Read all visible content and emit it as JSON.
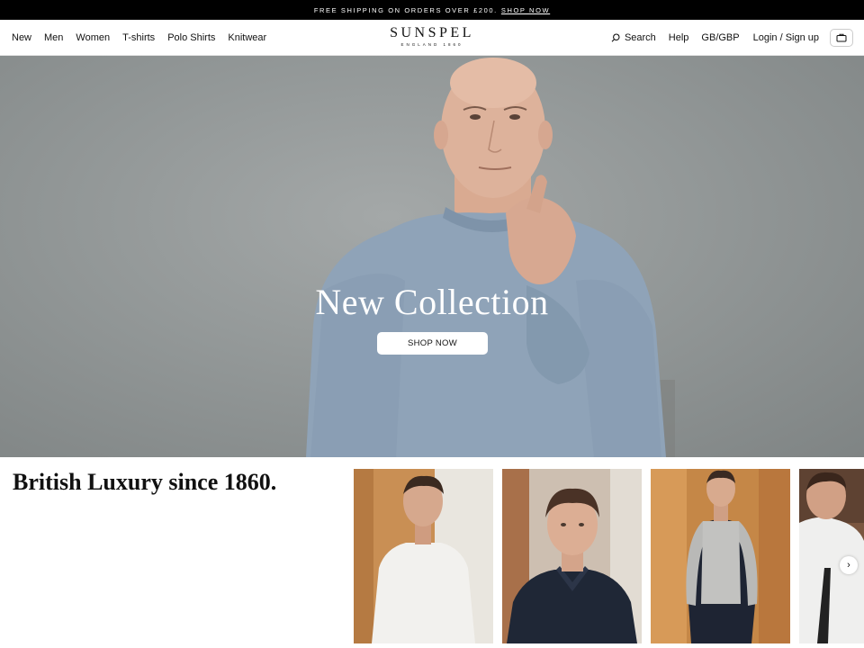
{
  "announcement": {
    "text": "FREE SHIPPING ON ORDERS OVER £200.",
    "link": "SHOP NOW"
  },
  "nav": {
    "left": [
      "New",
      "Men",
      "Women",
      "T-shirts",
      "Polo Shirts",
      "Knitwear"
    ],
    "search_label": "Search",
    "help_label": "Help",
    "region_label": "GB/GBP",
    "login_label": "Login / Sign up"
  },
  "brand": {
    "wordmark": "SUNSPEL",
    "sub": "ENGLAND 1860"
  },
  "hero": {
    "title": "New Collection",
    "button": "SHOP NOW"
  },
  "section": {
    "tagline": "British Luxury since 1860."
  },
  "icons": {
    "search": "search-icon",
    "bag": "bag-icon",
    "next": "chevron-right-icon"
  },
  "colors": {
    "announcement_bg": "#000000",
    "hero_bg": "#969b9b",
    "sweater": "#8fa3b8"
  }
}
